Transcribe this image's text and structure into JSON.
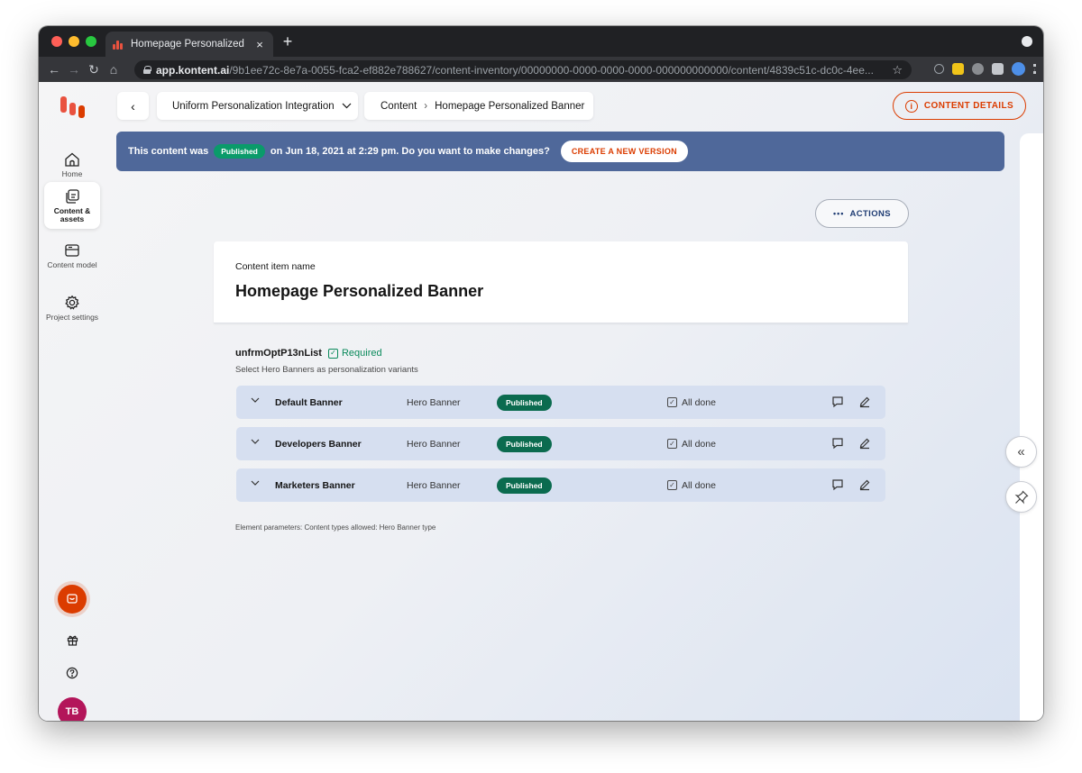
{
  "browser": {
    "tab_title": "Homepage Personalized Banne",
    "tab_close": "×",
    "new_tab": "+",
    "url_domain": "app.kontent.ai",
    "url_path": "/9b1ee72c-8e7a-0055-fca2-ef882e788627/content-inventory/00000000-0000-0000-0000-000000000000/content/4839c51c-dc0c-4ee..."
  },
  "sidebar": {
    "items": [
      {
        "label": "Home",
        "icon": "home-icon",
        "active": false
      },
      {
        "label": "Content & assets",
        "icon": "content-assets-icon",
        "active": true
      },
      {
        "label": "Content model",
        "icon": "content-model-icon",
        "active": false
      },
      {
        "label": "Project settings",
        "icon": "gear-icon",
        "active": false
      }
    ],
    "avatar_initials": "TB"
  },
  "header": {
    "project_name": "Uniform Personalization Integration",
    "breadcrumb": [
      "Content",
      "Homepage Personalized Banner"
    ],
    "content_details_label": "CONTENT DETAILS"
  },
  "notice": {
    "prefix": "This content was",
    "status": "Published",
    "suffix": "on Jun 18, 2021 at 2:29 pm. Do you want to make changes?",
    "action_label": "CREATE A NEW VERSION"
  },
  "actions_label": "ACTIONS",
  "content_item": {
    "name_label": "Content item name",
    "name_value": "Homepage Personalized Banner"
  },
  "element": {
    "codename": "unfrmOptP13nList",
    "required_label": "Required",
    "guidelines": "Select Hero Banners as personalization variants",
    "variants": [
      {
        "name": "Default Banner",
        "type": "Hero Banner",
        "status": "Published",
        "done": "All done"
      },
      {
        "name": "Developers Banner",
        "type": "Hero Banner",
        "status": "Published",
        "done": "All done"
      },
      {
        "name": "Marketers Banner",
        "type": "Hero Banner",
        "status": "Published",
        "done": "All done"
      }
    ],
    "parameters": "Element parameters: Content types allowed: Hero Banner type"
  },
  "colors": {
    "accent": "#db3c00",
    "notice_bg": "#4f689a",
    "published_green": "#0b6b4f",
    "row_bg": "#d6dff0"
  }
}
